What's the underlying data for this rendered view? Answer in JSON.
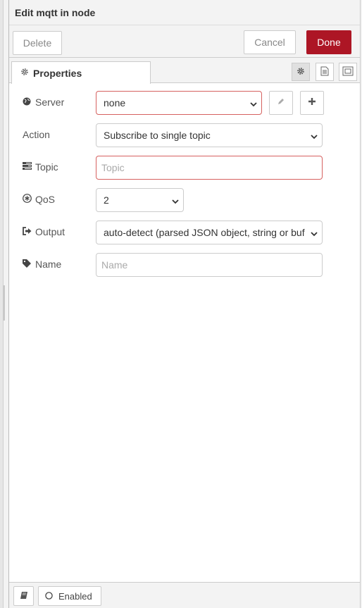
{
  "dialog": {
    "title": "Edit mqtt in node"
  },
  "toolbar": {
    "delete_label": "Delete",
    "cancel_label": "Cancel",
    "done_label": "Done",
    "done_color": "#ad1625"
  },
  "tabs": [
    {
      "label": "Properties",
      "icon": "gear-icon",
      "active": true
    }
  ],
  "tab_icons": [
    "gear-icon",
    "description-icon",
    "appearance-icon"
  ],
  "form": {
    "server": {
      "label": "Server",
      "icon": "globe-icon",
      "value": "none",
      "invalid": true
    },
    "action": {
      "label": "Action",
      "value": "Subscribe to single topic"
    },
    "topic": {
      "label": "Topic",
      "icon": "tasks-icon",
      "value": "",
      "placeholder": "Topic",
      "invalid": true
    },
    "qos": {
      "label": "QoS",
      "icon": "qos-icon",
      "value": "2"
    },
    "output": {
      "label": "Output",
      "icon": "sign-out-icon",
      "value": "auto-detect (parsed JSON object, string or buf"
    },
    "name": {
      "label": "Name",
      "icon": "tag-icon",
      "value": "",
      "placeholder": "Name"
    }
  },
  "footer": {
    "enabled_label": "Enabled",
    "book_icon": "book-icon"
  },
  "colors": {
    "invalid_border": "#d6615f",
    "header_bg": "#f3f3f3"
  }
}
